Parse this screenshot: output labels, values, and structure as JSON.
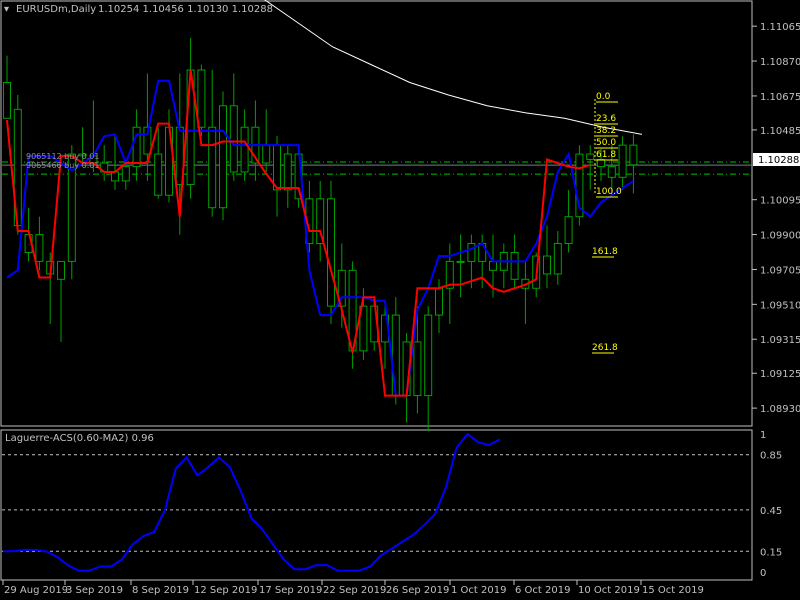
{
  "header": {
    "symbol_label": "EURUSDm,Daily",
    "ohlc": "1.10254 1.10456 1.10130 1.10288"
  },
  "current_price": "1.10288",
  "price_axis_labels": [
    "1.11065",
    "1.10870",
    "1.10675",
    "1.10485",
    "1.10095",
    "1.09900",
    "1.09705",
    "1.09510",
    "1.09315",
    "1.09125",
    "1.08930"
  ],
  "date_axis_labels": [
    "29 Aug 2019",
    "3 Sep 2019",
    "8 Sep 2019",
    "12 Sep 2019",
    "17 Sep 2019",
    "22 Sep 2019",
    "26 Sep 2019",
    "1 Oct 2019",
    "6 Oct 2019",
    "10 Oct 2019",
    "15 Oct 2019"
  ],
  "hline_labels": [
    "9065112 buy 0.01",
    "9065466 buy 0.01"
  ],
  "fibo_labels": [
    "0.0",
    "23.6",
    "38.2",
    "50.0",
    "61.8",
    "100.0",
    "161.8",
    "261.8"
  ],
  "indicator": {
    "title": "Laguerre-ACS(0.60-MA2) 0.96",
    "axis_labels": [
      "1",
      "0.85",
      "0.45",
      "0.15",
      "0"
    ]
  },
  "colors": {
    "background": "#000000",
    "grid": "#c0c0c0",
    "bull_candle": "#00a000",
    "bear_candle": "#00a000",
    "ma_fast": "#ff0000",
    "ma_slow": "#0000ff",
    "ma_long": "#ffffff",
    "fibo": "#ffff00",
    "order_line": "#00c000",
    "price_box": "#ffffff"
  },
  "chart_data": {
    "type": "candlestick",
    "ylim": [
      1.0883,
      1.112
    ],
    "candles": [
      {
        "o": 1.1075,
        "h": 1.109,
        "l": 1.106,
        "c": 1.1055
      },
      {
        "o": 1.106,
        "h": 1.1068,
        "l": 1.099,
        "c": 1.0995
      },
      {
        "o": 1.099,
        "h": 1.1005,
        "l": 1.0975,
        "c": 1.098
      },
      {
        "o": 1.099,
        "h": 1.1,
        "l": 1.097,
        "c": 1.0975
      },
      {
        "o": 1.0975,
        "h": 1.098,
        "l": 1.094,
        "c": 1.0968
      },
      {
        "o": 1.0965,
        "h": 1.097,
        "l": 1.093,
        "c": 1.0975
      },
      {
        "o": 1.0975,
        "h": 1.104,
        "l": 1.0965,
        "c": 1.1035
      },
      {
        "o": 1.1035,
        "h": 1.105,
        "l": 1.103,
        "c": 1.1034
      },
      {
        "o": 1.1034,
        "h": 1.1065,
        "l": 1.1025,
        "c": 1.103
      },
      {
        "o": 1.103,
        "h": 1.104,
        "l": 1.102,
        "c": 1.1025
      },
      {
        "o": 1.1025,
        "h": 1.1045,
        "l": 1.1015,
        "c": 1.102
      },
      {
        "o": 1.102,
        "h": 1.103,
        "l": 1.1015,
        "c": 1.1028
      },
      {
        "o": 1.1028,
        "h": 1.106,
        "l": 1.102,
        "c": 1.105
      },
      {
        "o": 1.105,
        "h": 1.108,
        "l": 1.102,
        "c": 1.1035
      },
      {
        "o": 1.1035,
        "h": 1.105,
        "l": 1.101,
        "c": 1.1012
      },
      {
        "o": 1.1012,
        "h": 1.106,
        "l": 1.1008,
        "c": 1.105
      },
      {
        "o": 1.105,
        "h": 1.108,
        "l": 1.099,
        "c": 1.1018
      },
      {
        "o": 1.1018,
        "h": 1.11,
        "l": 1.101,
        "c": 1.1082
      },
      {
        "o": 1.1082,
        "h": 1.1085,
        "l": 1.1045,
        "c": 1.105
      },
      {
        "o": 1.105,
        "h": 1.1082,
        "l": 1.1,
        "c": 1.1005
      },
      {
        "o": 1.1005,
        "h": 1.107,
        "l": 1.0998,
        "c": 1.1062
      },
      {
        "o": 1.1062,
        "h": 1.108,
        "l": 1.102,
        "c": 1.1025
      },
      {
        "o": 1.1025,
        "h": 1.106,
        "l": 1.102,
        "c": 1.105
      },
      {
        "o": 1.105,
        "h": 1.1065,
        "l": 1.102,
        "c": 1.103
      },
      {
        "o": 1.103,
        "h": 1.106,
        "l": 1.1025,
        "c": 1.104
      },
      {
        "o": 1.104,
        "h": 1.1045,
        "l": 1.1,
        "c": 1.1015
      },
      {
        "o": 1.1015,
        "h": 1.104,
        "l": 1.1005,
        "c": 1.1035
      },
      {
        "o": 1.1035,
        "h": 1.104,
        "l": 1.1005,
        "c": 1.101
      },
      {
        "o": 1.101,
        "h": 1.102,
        "l": 1.098,
        "c": 1.0985
      },
      {
        "o": 1.0985,
        "h": 1.102,
        "l": 1.0975,
        "c": 1.101
      },
      {
        "o": 1.101,
        "h": 1.102,
        "l": 1.094,
        "c": 1.095
      },
      {
        "o": 1.095,
        "h": 1.0985,
        "l": 1.0938,
        "c": 1.097
      },
      {
        "o": 1.097,
        "h": 1.0975,
        "l": 1.0915,
        "c": 1.0925
      },
      {
        "o": 1.0925,
        "h": 1.096,
        "l": 1.092,
        "c": 1.095
      },
      {
        "o": 1.095,
        "h": 1.0955,
        "l": 1.0925,
        "c": 1.093
      },
      {
        "o": 1.093,
        "h": 1.095,
        "l": 1.0915,
        "c": 1.0945
      },
      {
        "o": 1.0945,
        "h": 1.0955,
        "l": 1.0895,
        "c": 1.09
      },
      {
        "o": 1.09,
        "h": 1.0935,
        "l": 1.0885,
        "c": 1.093
      },
      {
        "o": 1.093,
        "h": 1.095,
        "l": 1.089,
        "c": 1.09
      },
      {
        "o": 1.09,
        "h": 1.095,
        "l": 1.088,
        "c": 1.0945
      },
      {
        "o": 1.0945,
        "h": 1.0965,
        "l": 1.0935,
        "c": 1.096
      },
      {
        "o": 1.096,
        "h": 1.0985,
        "l": 1.094,
        "c": 1.0975
      },
      {
        "o": 1.0975,
        "h": 1.099,
        "l": 1.0955,
        "c": 1.0975
      },
      {
        "o": 1.0975,
        "h": 1.099,
        "l": 1.096,
        "c": 1.0985
      },
      {
        "o": 1.0985,
        "h": 1.099,
        "l": 1.096,
        "c": 1.0975
      },
      {
        "o": 1.0975,
        "h": 1.099,
        "l": 1.0955,
        "c": 1.097
      },
      {
        "o": 1.097,
        "h": 1.0985,
        "l": 1.096,
        "c": 1.098
      },
      {
        "o": 1.098,
        "h": 1.099,
        "l": 1.096,
        "c": 1.0965
      },
      {
        "o": 1.0965,
        "h": 1.0975,
        "l": 1.094,
        "c": 1.096
      },
      {
        "o": 1.096,
        "h": 1.098,
        "l": 1.0955,
        "c": 1.0978
      },
      {
        "o": 1.0978,
        "h": 1.0995,
        "l": 1.096,
        "c": 1.0968
      },
      {
        "o": 1.0968,
        "h": 1.0992,
        "l": 1.0962,
        "c": 1.0985
      },
      {
        "o": 1.0985,
        "h": 1.1015,
        "l": 1.098,
        "c": 1.1
      },
      {
        "o": 1.1,
        "h": 1.104,
        "l": 1.0995,
        "c": 1.1035
      },
      {
        "o": 1.1035,
        "h": 1.104,
        "l": 1.1015,
        "c": 1.1032
      },
      {
        "o": 1.1032,
        "h": 1.1038,
        "l": 1.102,
        "c": 1.1028
      },
      {
        "o": 1.1028,
        "h": 1.104,
        "l": 1.1012,
        "c": 1.1022
      },
      {
        "o": 1.1022,
        "h": 1.1045,
        "l": 1.1015,
        "c": 1.104
      },
      {
        "o": 1.104,
        "h": 1.1046,
        "l": 1.1013,
        "c": 1.1029
      }
    ],
    "ma_fast": [
      1.1054,
      1.0992,
      1.0992,
      1.0966,
      1.0966,
      1.1034,
      1.1034,
      1.103,
      1.103,
      1.1025,
      1.1025,
      1.103,
      1.103,
      1.103,
      1.1052,
      1.1052,
      1.1,
      1.1082,
      1.104,
      1.104,
      1.1042,
      1.1042,
      1.1042,
      1.1033,
      1.1024,
      1.1016,
      1.1016,
      1.1016,
      1.0992,
      1.0992,
      1.097,
      1.0948,
      1.0924,
      1.0955,
      1.0955,
      1.09,
      1.09,
      1.09,
      1.096,
      1.096,
      1.096,
      1.0962,
      1.0962,
      1.0964,
      1.0966,
      1.096,
      1.0958,
      1.096,
      1.0962,
      1.0965,
      1.1032,
      1.103,
      1.1028,
      1.1027,
      1.1029
    ],
    "ma_slow": [
      1.0966,
      1.097,
      1.1034,
      1.1034,
      1.1034,
      1.103,
      1.1026,
      1.103,
      1.1034,
      1.1045,
      1.1046,
      1.103,
      1.1046,
      1.1046,
      1.1076,
      1.1076,
      1.1048,
      1.1048,
      1.1048,
      1.1048,
      1.1048,
      1.104,
      1.104,
      1.104,
      1.104,
      1.104,
      1.104,
      1.104,
      1.097,
      1.0945,
      1.0945,
      1.0955,
      1.0955,
      1.0955,
      1.0953,
      1.0953,
      1.09,
      1.09,
      1.0948,
      1.096,
      1.0978,
      1.0978,
      1.098,
      1.0982,
      1.0985,
      1.0975,
      1.0975,
      1.0975,
      1.0975,
      1.0985,
      1.1,
      1.1025,
      1.1035,
      1.1005,
      1.1,
      1.1008,
      1.1012,
      1.1016,
      1.102
    ],
    "ma_long_segment": [
      1.1125,
      1.111,
      1.1095,
      1.1085,
      1.1075,
      1.1068,
      1.1062,
      1.1058,
      1.1055,
      1.105,
      1.1046
    ],
    "fibo_levels": [
      0.0,
      23.6,
      38.2,
      50.0,
      61.8,
      100.0,
      161.8,
      261.8
    ],
    "laguerre": {
      "ylim": [
        0,
        1
      ],
      "levels": [
        0.85,
        0.45,
        0.15
      ],
      "values": [
        0.15,
        0.15,
        0.16,
        0.16,
        0.15,
        0.11,
        0.05,
        0.01,
        0.01,
        0.04,
        0.04,
        0.09,
        0.2,
        0.26,
        0.29,
        0.45,
        0.75,
        0.83,
        0.7,
        0.76,
        0.83,
        0.76,
        0.59,
        0.39,
        0.31,
        0.2,
        0.09,
        0.02,
        0.02,
        0.05,
        0.05,
        0.01,
        0.01,
        0.01,
        0.04,
        0.12,
        0.17,
        0.22,
        0.27,
        0.34,
        0.42,
        0.61,
        0.9,
        1.0,
        0.94,
        0.92,
        0.96
      ]
    }
  }
}
